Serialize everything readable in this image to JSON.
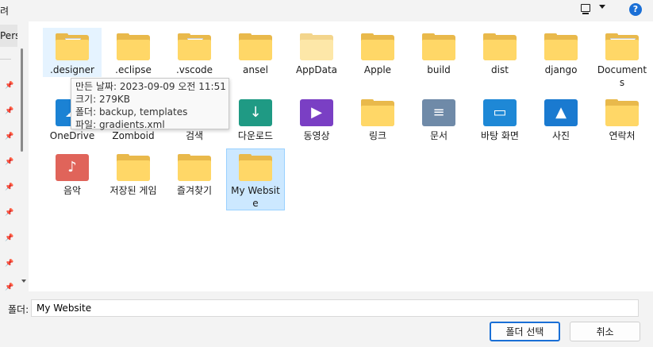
{
  "header": {
    "title_fragment": "려"
  },
  "sidebar": {
    "selected_label": "Pers"
  },
  "items": [
    {
      "name": ".designer",
      "type": "folder-doc"
    },
    {
      "name": ".eclipse",
      "type": "folder"
    },
    {
      "name": ".vscode",
      "type": "folder-doc"
    },
    {
      "name": "ansel",
      "type": "folder"
    },
    {
      "name": "AppData",
      "type": "folder-light"
    },
    {
      "name": "Apple",
      "type": "folder"
    },
    {
      "name": "build",
      "type": "folder"
    },
    {
      "name": "dist",
      "type": "folder"
    },
    {
      "name": "django",
      "type": "folder"
    },
    {
      "name": "Documents",
      "type": "folder-doc-wide"
    },
    {
      "name": "OneDrive",
      "type": "onedrive"
    },
    {
      "name": "Zomboid",
      "type": "folder"
    },
    {
      "name": "검색",
      "type": "search"
    },
    {
      "name": "다운로드",
      "type": "downloads"
    },
    {
      "name": "동영상",
      "type": "videos"
    },
    {
      "name": "링크",
      "type": "folder"
    },
    {
      "name": "문서",
      "type": "documents"
    },
    {
      "name": "바탕 화면",
      "type": "desktop"
    },
    {
      "name": "사진",
      "type": "pictures"
    },
    {
      "name": "연락처",
      "type": "folder"
    },
    {
      "name": "음악",
      "type": "music"
    },
    {
      "name": "저장된 게임",
      "type": "folder"
    },
    {
      "name": "즐겨찾기",
      "type": "folder"
    },
    {
      "name": "My Website",
      "type": "folder"
    }
  ],
  "tooltip": {
    "line1": "만든 날짜: 2023-09-09 오전 11:51",
    "line2": "크기: 279KB",
    "line3": "폴더: backup, templates",
    "line4": "파일: gradients.xml"
  },
  "footer": {
    "folder_label": "폴더:",
    "folder_value": "My Website",
    "select_button": "폴더 선택",
    "cancel_button": "취소"
  }
}
